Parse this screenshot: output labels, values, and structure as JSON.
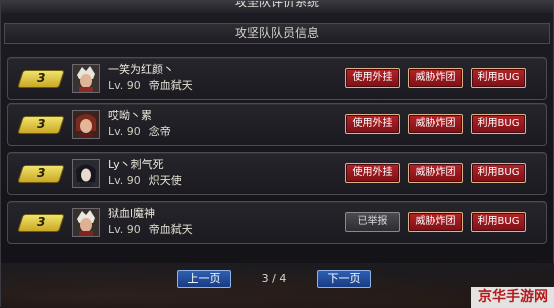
{
  "window": {
    "title": "攻坚队评价系统"
  },
  "section": {
    "title": "攻坚队队员信息"
  },
  "members": [
    {
      "badge": "3",
      "name": "一笑为红颜丶",
      "level": "Lv. 90",
      "job": "帝血弑天",
      "btn_plugin": "使用外挂",
      "btn_threat": "威胁炸团",
      "btn_bug": "利用BUG"
    },
    {
      "badge": "3",
      "name": "哎呦丶累",
      "level": "Lv. 90",
      "job": "念帝",
      "btn_plugin": "使用外挂",
      "btn_threat": "威胁炸团",
      "btn_bug": "利用BUG"
    },
    {
      "badge": "3",
      "name": "Ly丶刺气死",
      "level": "Lv. 90",
      "job": "炽天使",
      "btn_plugin": "使用外挂",
      "btn_threat": "威胁炸团",
      "btn_bug": "利用BUG"
    },
    {
      "badge": "3",
      "name": "狱血l魔神",
      "level": "Lv. 90",
      "job": "帝血弑天",
      "btn_plugin": "已举报",
      "btn_threat": "威胁炸团",
      "btn_bug": "利用BUG"
    }
  ],
  "pager": {
    "prev": "上一页",
    "indicator": "3 / 4",
    "next": "下一页"
  },
  "watermark": "京华手游网"
}
